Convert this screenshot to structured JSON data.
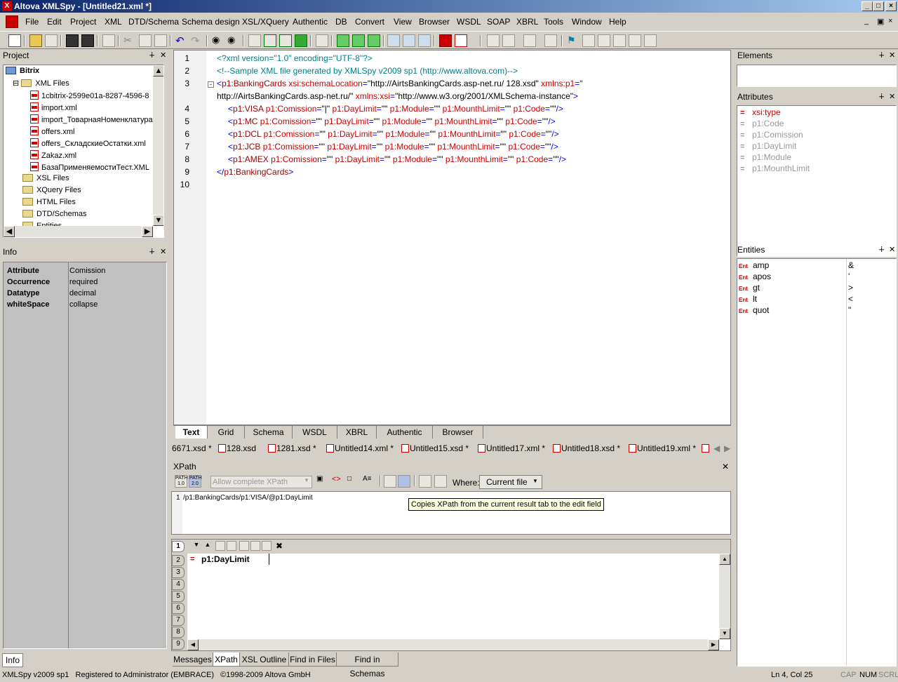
{
  "window": {
    "title": "Altova XMLSpy - [Untitled21.xml *]",
    "minimize": "_",
    "maximize": "□",
    "close": "×"
  },
  "menu": [
    "File",
    "Edit",
    "Project",
    "XML",
    "DTD/Schema",
    "Schema design",
    "XSL/XQuery",
    "Authentic",
    "DB",
    "Convert",
    "View",
    "Browser",
    "WSDL",
    "SOAP",
    "XBRL",
    "Tools",
    "Window",
    "Help"
  ],
  "project": {
    "title": "Project",
    "root": "Bitrix",
    "xml_folder": "XML Files",
    "files": [
      "1cbitrix-2599e01a-8287-4596-8",
      "import.xml",
      "import_ТоварнаяНоменклатура",
      "offers.xml",
      "offers_СкладскиеОстатки.xml",
      "Zakaz.xml",
      "БазаПрименяемостиТест.XML"
    ],
    "folders": [
      "XSL Files",
      "XQuery Files",
      "HTML Files",
      "DTD/Schemas",
      "Entities"
    ]
  },
  "info": {
    "title": "Info",
    "rows": [
      {
        "key": "Attribute",
        "value": "Comission"
      },
      {
        "key": "Occurrence",
        "value": "required"
      },
      {
        "key": "Datatype",
        "value": "decimal"
      },
      {
        "key": "whiteSpace",
        "value": "collapse"
      }
    ],
    "tab": "Info"
  },
  "editor": {
    "line_numbers": [
      "1",
      "2",
      "3",
      "",
      "4",
      "5",
      "6",
      "7",
      "8",
      "9",
      "10"
    ],
    "view_tabs": [
      "Text",
      "Grid",
      "Schema",
      "WSDL",
      "XBRL",
      "Authentic",
      "Browser"
    ],
    "active_view": "Text"
  },
  "doc_tabs": [
    "6671.xsd *",
    "128.xsd",
    "1281.xsd *",
    "Untitled14.xml *",
    "Untitled15.xsd *",
    "Untitled17.xml *",
    "Untitled18.xsd *",
    "Untitled19.xml *"
  ],
  "xpath": {
    "title": "XPath",
    "placeholder": "Allow complete XPath",
    "where_label": "Where:",
    "where_value": "Current file",
    "expr_line": "1",
    "expression": "/p1:BankingCards/p1:VISA/@p1:DayLimit",
    "tooltip": "Copies XPath from the current result tab to the edit field",
    "result": "p1:DayLimit",
    "result_tabs": [
      "1",
      "2",
      "3",
      "4",
      "5",
      "6",
      "7",
      "8",
      "9"
    ]
  },
  "bottom_tabs": [
    "Messages",
    "XPath",
    "XSL Outline",
    "Find in Files",
    "Find in Schemas"
  ],
  "elements": {
    "title": "Elements"
  },
  "attributes": {
    "title": "Attributes",
    "items": [
      "xsi:type",
      "p1:Code",
      "p1:Comission",
      "p1:DayLimit",
      "p1:Module",
      "p1:MounthLimit"
    ]
  },
  "entities": {
    "title": "Entities",
    "items": [
      {
        "name": "amp",
        "value": "&"
      },
      {
        "name": "apos",
        "value": "'"
      },
      {
        "name": "gt",
        "value": ">"
      },
      {
        "name": "lt",
        "value": "<"
      },
      {
        "name": "quot",
        "value": "\""
      }
    ]
  },
  "status": {
    "left": "XMLSpy v2009 sp1   Registered to Administrator (EMBRACE)   ©1998-2009 Altova GmbH",
    "position": "Ln 4, Col 25",
    "cap": "CAP",
    "num": "NUM",
    "scrl": "SCRL"
  },
  "icons": [
    "altova-logo-icon",
    "new-file-icon",
    "open-icon",
    "save-icon",
    "print-icon",
    "cut-icon",
    "copy-icon",
    "paste-icon",
    "undo-icon",
    "redo-icon",
    "find-icon",
    "pin-icon",
    "close-icon",
    "folder-icon",
    "xml-file-icon",
    "entity-icon",
    "attribute-icon"
  ]
}
